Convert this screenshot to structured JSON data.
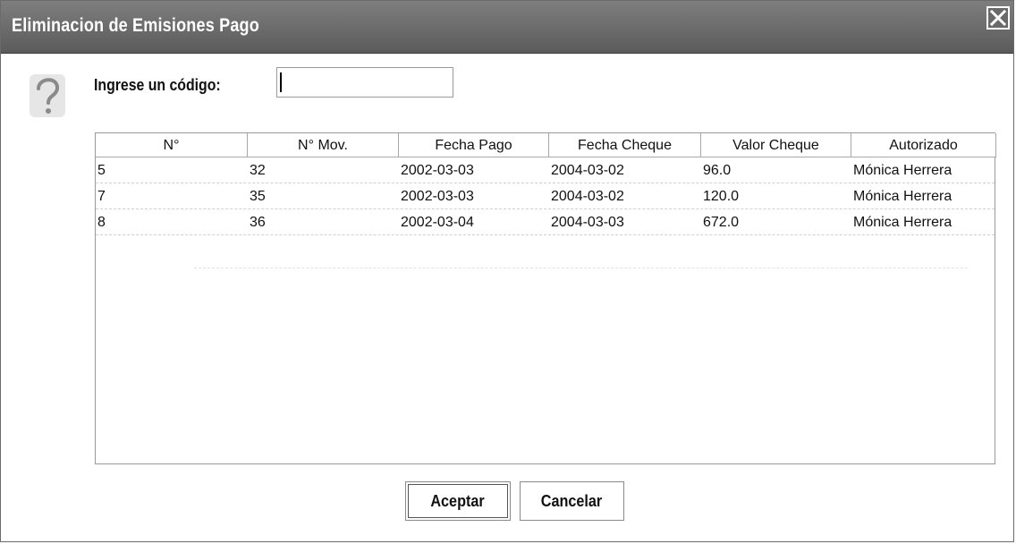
{
  "window": {
    "title": "Eliminacion de Emisiones Pago",
    "close_icon": "close-icon"
  },
  "form": {
    "help_icon": "question-icon",
    "code_label": "Ingrese un código:",
    "code_value": ""
  },
  "table": {
    "columns": [
      "N°",
      "N° Mov.",
      "Fecha Pago",
      "Fecha Cheque",
      "Valor Cheque",
      "Autorizado"
    ],
    "rows": [
      [
        "5",
        "32",
        "2002-03-03",
        "2004-03-02",
        "96.0",
        "Mónica Herrera"
      ],
      [
        "7",
        "35",
        "2002-03-03",
        "2004-03-02",
        "120.0",
        "Mónica Herrera"
      ],
      [
        "8",
        "36",
        "2002-03-04",
        "2004-03-03",
        "672.0",
        "Mónica Herrera"
      ]
    ]
  },
  "buttons": {
    "accept_label": "Aceptar",
    "cancel_label": "Cancelar"
  }
}
